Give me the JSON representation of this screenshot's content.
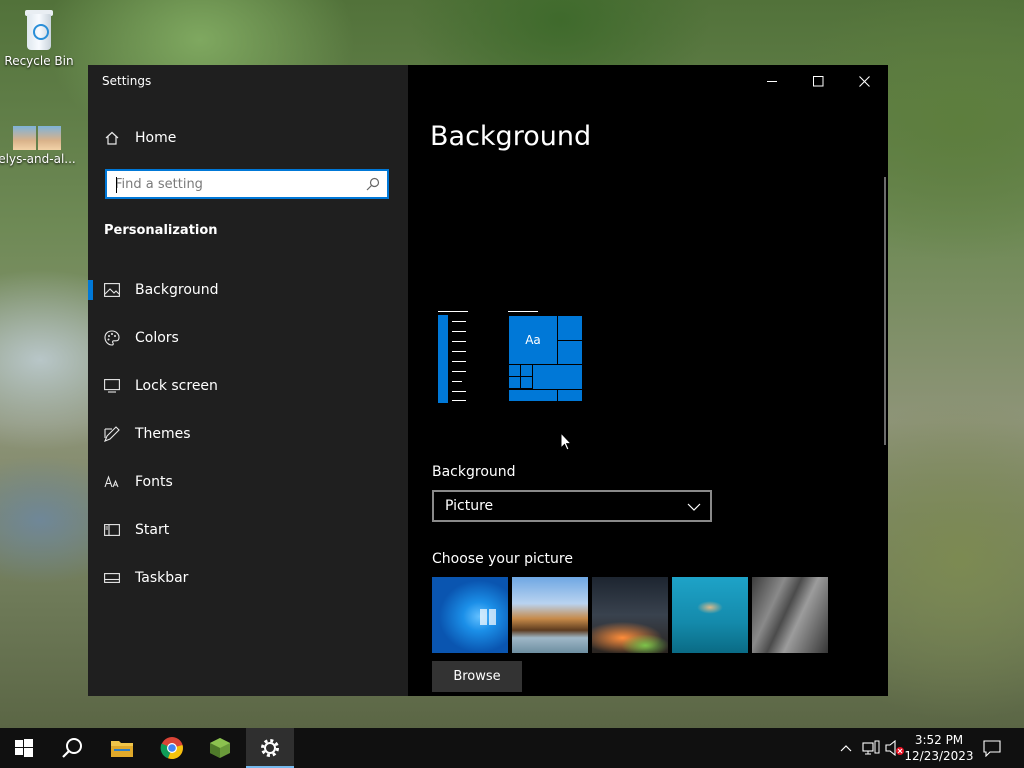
{
  "desktop": {
    "icons": [
      {
        "label": "Recycle Bin",
        "icon": "recycle-bin-icon"
      },
      {
        "label": "elys-and-al...",
        "icon": "photo-file-icon"
      }
    ]
  },
  "window": {
    "app_title": "Settings",
    "controls": {
      "minimize": "minimize-icon",
      "maximize": "maximize-icon",
      "close": "close-icon"
    }
  },
  "sidebar": {
    "home_label": "Home",
    "search": {
      "placeholder": "Find a setting",
      "value": ""
    },
    "section_title": "Personalization",
    "items": [
      {
        "label": "Background",
        "icon": "image-icon",
        "selected": true
      },
      {
        "label": "Colors",
        "icon": "palette-icon",
        "selected": false
      },
      {
        "label": "Lock screen",
        "icon": "lock-screen-icon",
        "selected": false
      },
      {
        "label": "Themes",
        "icon": "themes-brush-icon",
        "selected": false
      },
      {
        "label": "Fonts",
        "icon": "fonts-icon",
        "selected": false
      },
      {
        "label": "Start",
        "icon": "start-menu-icon",
        "selected": false
      },
      {
        "label": "Taskbar",
        "icon": "taskbar-icon",
        "selected": false
      }
    ]
  },
  "main": {
    "page_title": "Background",
    "preview": {
      "tile_text": "Aa"
    },
    "background_label": "Background",
    "background_value": "Picture",
    "choose_label": "Choose your picture",
    "pictures": [
      "windows-hero-blue",
      "beach-rock-arch",
      "night-sky-tent",
      "underwater-swimmer",
      "rock-cliff"
    ],
    "browse_label": "Browse"
  },
  "taskbar": {
    "apps": [
      "start-icon",
      "search-icon",
      "file-explorer-icon",
      "chrome-icon",
      "minecraft-icon",
      "settings-gear-icon"
    ],
    "active_app": "settings-gear-icon",
    "time": "3:52 PM",
    "date": "12/23/2023"
  },
  "colors": {
    "accent": "#0078d7",
    "sidebar_bg": "#1f1f1f",
    "main_bg": "#000000",
    "taskbar_bg": "#101010"
  }
}
